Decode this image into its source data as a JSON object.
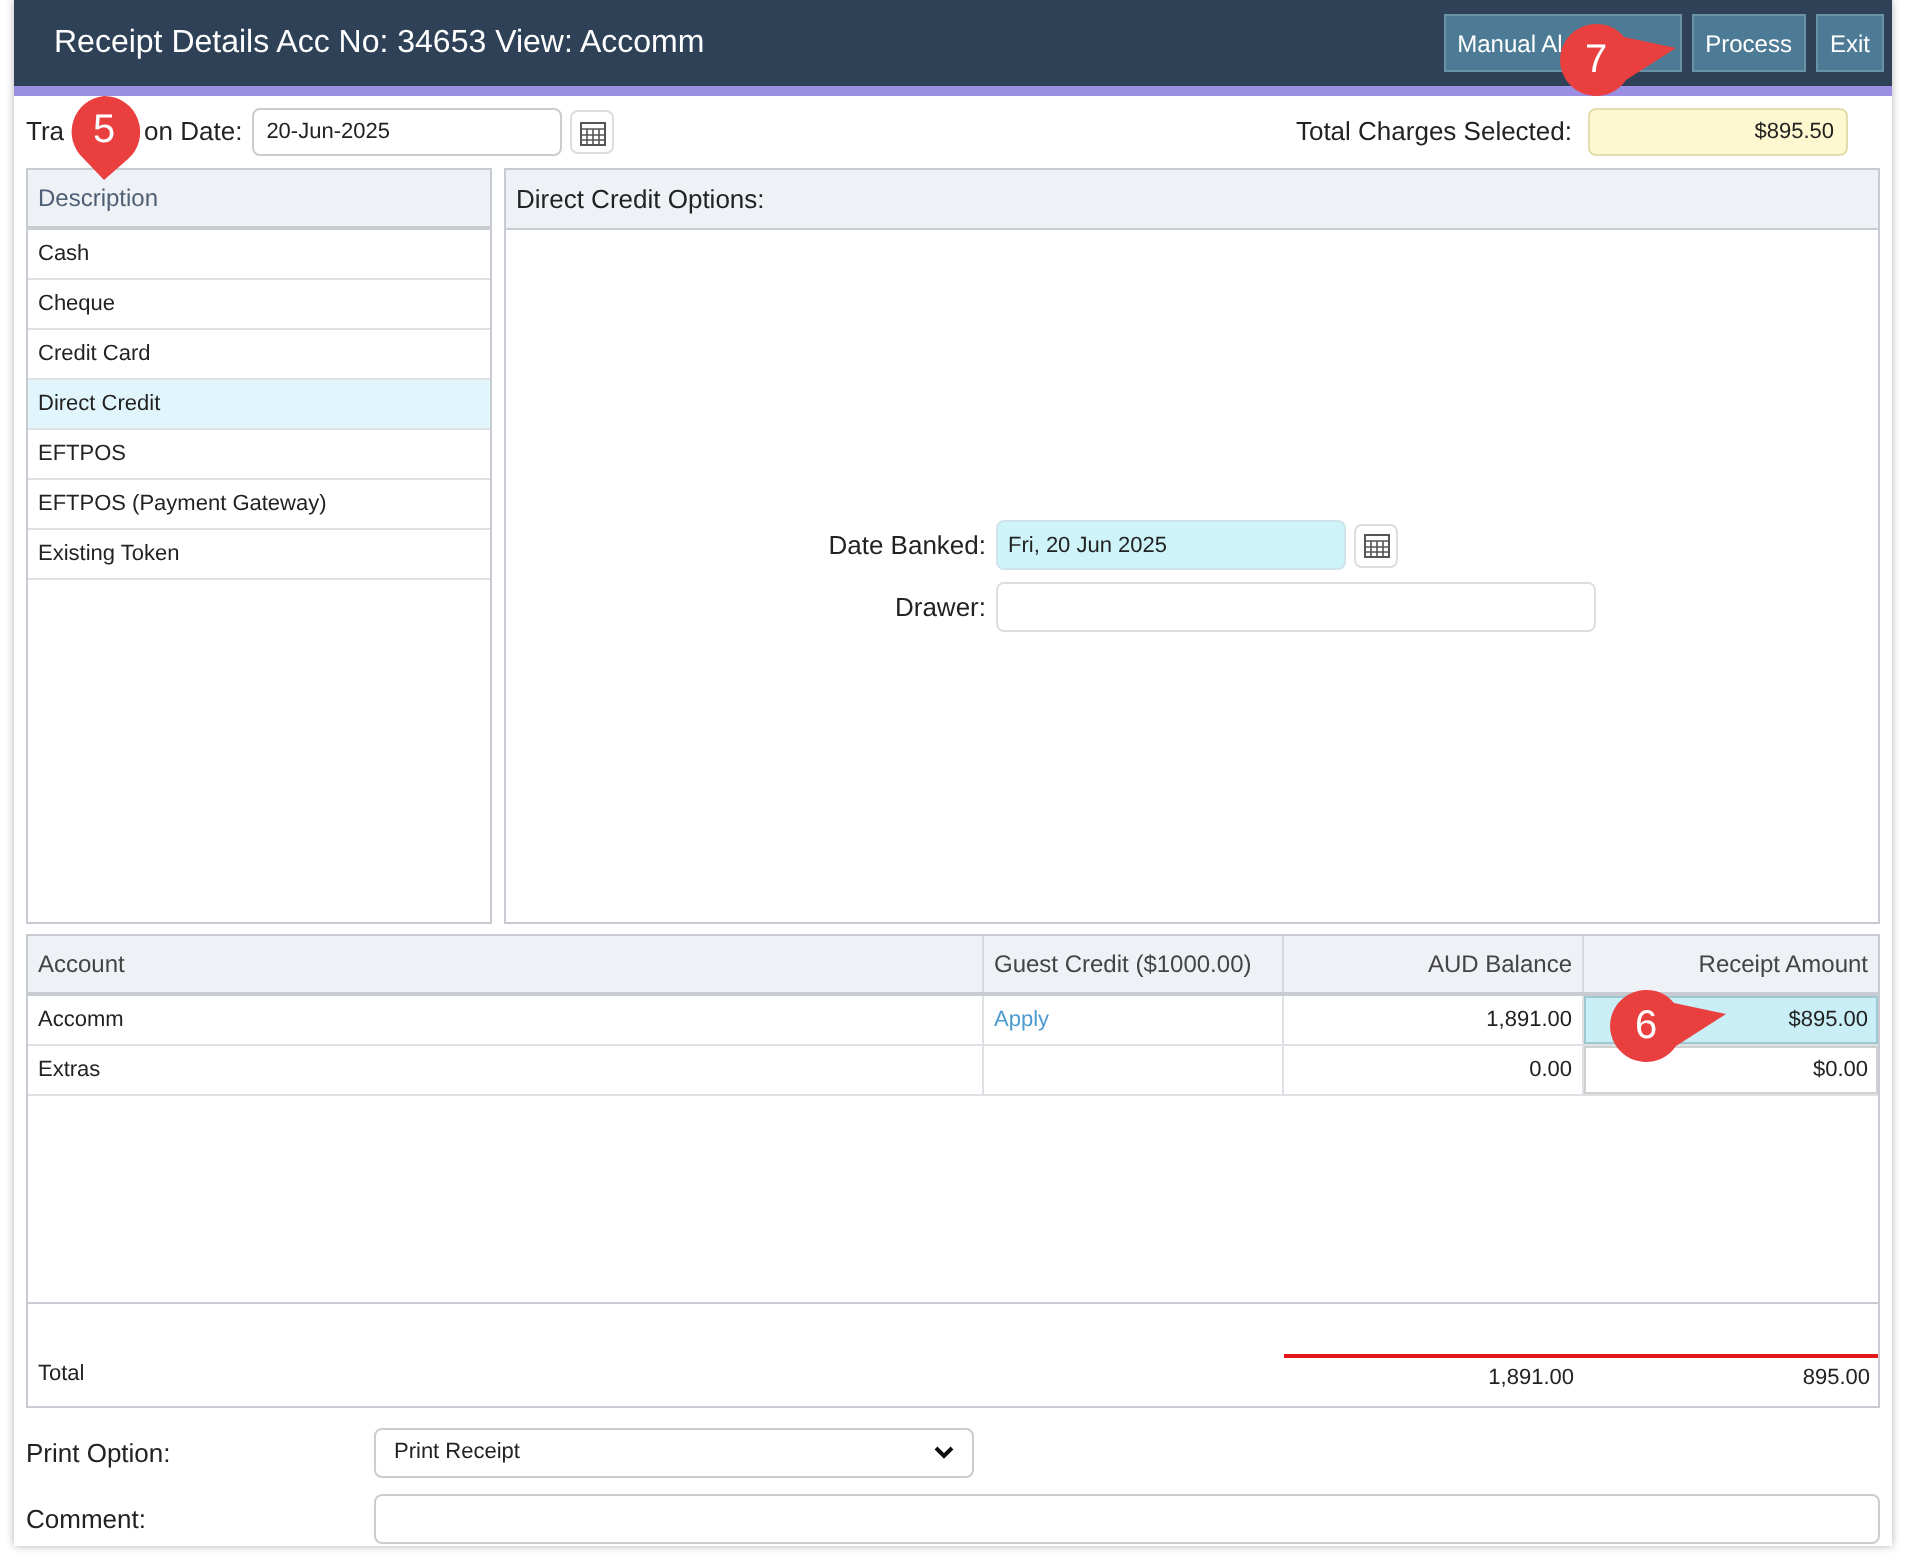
{
  "window": {
    "title": "Receipt Details Acc No: 34653 View: Accomm"
  },
  "header_buttons": [
    {
      "label": "Manual Al"
    },
    {
      "label": "Process"
    },
    {
      "label": "Exit"
    }
  ],
  "transaction_date": {
    "label_parts": [
      "Tra",
      "on Date:"
    ],
    "value": "20-Jun-2025"
  },
  "total_charges": {
    "label": "Total Charges Selected:",
    "value": "$895.50"
  },
  "payment_methods": {
    "heading": "Description",
    "items": [
      {
        "label": "Cash",
        "selected": false
      },
      {
        "label": "Cheque",
        "selected": false
      },
      {
        "label": "Credit Card",
        "selected": false
      },
      {
        "label": "Direct Credit",
        "selected": true
      },
      {
        "label": "EFTPOS",
        "selected": false
      },
      {
        "label": "EFTPOS (Payment Gateway)",
        "selected": false
      },
      {
        "label": "Existing Token",
        "selected": false
      }
    ]
  },
  "options_panel": {
    "title": "Direct Credit Options:",
    "date_banked": {
      "label": "Date Banked:",
      "value": "Fri, 20 Jun 2025"
    },
    "drawer": {
      "label": "Drawer:"
    }
  },
  "table": {
    "columns": [
      "Account",
      "Guest Credit ($1000.00)",
      "AUD Balance",
      "Receipt Amount"
    ],
    "rows": [
      {
        "account": "Accomm",
        "guest_credit": "Apply",
        "balance": "1,891.00",
        "receipt": "$895.00",
        "active": true
      },
      {
        "account": "Extras",
        "balance": "0.00",
        "receipt": "$0.00",
        "active": false
      }
    ],
    "total": {
      "label": "Total",
      "balance": "1,891.00",
      "receipt": "895.00"
    }
  },
  "print_option": {
    "label": "Print Option:",
    "value": "Print Receipt"
  },
  "comment": {
    "label": "Comment:"
  },
  "callouts": [
    {
      "label": "5"
    },
    {
      "label": "6"
    },
    {
      "label": "7"
    }
  ]
}
